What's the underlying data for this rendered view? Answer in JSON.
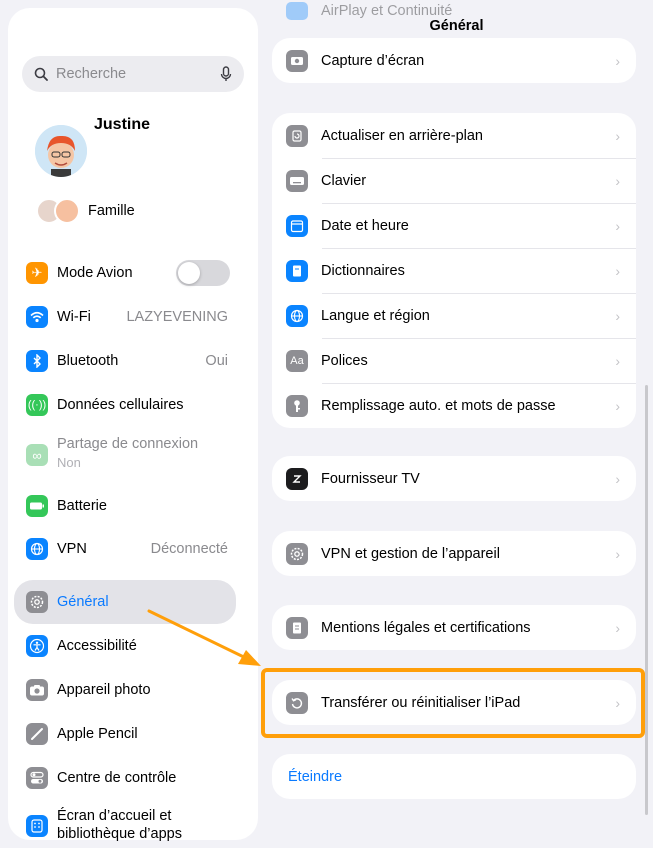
{
  "header": {
    "title": "Général"
  },
  "search": {
    "placeholder": "Recherche"
  },
  "profile": {
    "name": "Justine"
  },
  "family": {
    "label": "Famille"
  },
  "sidebar": {
    "items": [
      {
        "label": "Mode Avion",
        "icon": "airplane-icon",
        "color": "#ff9500"
      },
      {
        "label": "Wi-Fi",
        "value": "LAZYEVENING",
        "icon": "wifi-icon",
        "color": "#0a84ff"
      },
      {
        "label": "Bluetooth",
        "value": "Oui",
        "icon": "bluetooth-icon",
        "color": "#0a84ff"
      },
      {
        "label": "Données cellulaires",
        "icon": "antenna-icon",
        "color": "#34c759"
      },
      {
        "label": "Partage de connexion",
        "value": "Non",
        "icon": "link-icon",
        "color": "#34c759"
      },
      {
        "label": "Batterie",
        "icon": "battery-icon",
        "color": "#34c759"
      },
      {
        "label": "VPN",
        "value": "Déconnecté",
        "icon": "globe-icon",
        "color": "#0a84ff"
      },
      {
        "label": "Général",
        "icon": "gear-icon",
        "color": "#8e8e93"
      },
      {
        "label": "Accessibilité",
        "icon": "accessibility-icon",
        "color": "#0a84ff"
      },
      {
        "label": "Appareil photo",
        "icon": "camera-icon",
        "color": "#8e8e93"
      },
      {
        "label": "Apple Pencil",
        "icon": "pencil-icon",
        "color": "#8e8e93"
      },
      {
        "label": "Centre de contrôle",
        "icon": "switches-icon",
        "color": "#8e8e93"
      },
      {
        "label": "Écran d’accueil et bibliothèque d’apps",
        "icon": "home-grid-icon",
        "color": "#0a84ff"
      }
    ]
  },
  "main": {
    "top_partial": "AirPlay et Continuité",
    "group0": [
      {
        "label": "Capture d’écran",
        "icon": "camera-icon"
      }
    ],
    "group1": [
      {
        "label": "Actualiser en arrière-plan",
        "icon": "refresh-icon"
      },
      {
        "label": "Clavier",
        "icon": "keyboard-icon"
      },
      {
        "label": "Date et heure",
        "icon": "calendar-icon"
      },
      {
        "label": "Dictionnaires",
        "icon": "book-icon"
      },
      {
        "label": "Langue et région",
        "icon": "globe-icon"
      },
      {
        "label": "Polices",
        "icon": "font-icon"
      },
      {
        "label": "Remplissage auto. et mots de passe",
        "icon": "key-icon"
      }
    ],
    "group2": [
      {
        "label": "Fournisseur TV",
        "icon": "tv-icon"
      }
    ],
    "group3": [
      {
        "label": "VPN et gestion de l’appareil",
        "icon": "gear-icon"
      }
    ],
    "group4": [
      {
        "label": "Mentions légales et certifications",
        "icon": "document-icon"
      }
    ],
    "group5": [
      {
        "label": "Transférer ou réinitialiser l’iPad",
        "icon": "reset-icon"
      }
    ],
    "shutdown": "Éteindre"
  },
  "colors": {
    "accent": "#0a7aff",
    "highlight": "#ff9f0a"
  }
}
